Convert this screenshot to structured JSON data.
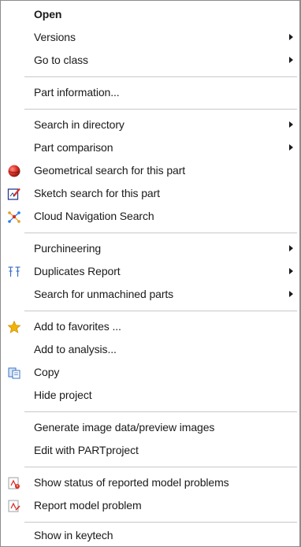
{
  "menu": {
    "items": [
      {
        "label": "Open",
        "icon": null,
        "submenu": false,
        "bold": true
      },
      {
        "label": "Versions",
        "icon": null,
        "submenu": true
      },
      {
        "label": "Go to class",
        "icon": null,
        "submenu": true
      },
      {
        "label": "Part information...",
        "icon": null,
        "submenu": false
      },
      {
        "label": "Search in directory",
        "icon": null,
        "submenu": true
      },
      {
        "label": "Part comparison",
        "icon": null,
        "submenu": true
      },
      {
        "label": "Geometrical search for this part",
        "icon": "red-sphere-icon",
        "submenu": false
      },
      {
        "label": "Sketch search for this part",
        "icon": "sketch-pencil-icon",
        "submenu": false
      },
      {
        "label": "Cloud Navigation Search",
        "icon": "cloud-network-icon",
        "submenu": false
      },
      {
        "label": "Purchineering",
        "icon": null,
        "submenu": true
      },
      {
        "label": "Duplicates Report",
        "icon": "duplicates-icon",
        "submenu": true
      },
      {
        "label": "Search for unmachined parts",
        "icon": null,
        "submenu": true
      },
      {
        "label": "Add to favorites ...",
        "icon": "star-icon",
        "submenu": false
      },
      {
        "label": "Add to analysis...",
        "icon": null,
        "submenu": false
      },
      {
        "label": "Copy",
        "icon": "copy-icon",
        "submenu": false
      },
      {
        "label": "Hide project",
        "icon": null,
        "submenu": false
      },
      {
        "label": "Generate image data/preview images",
        "icon": null,
        "submenu": false
      },
      {
        "label": "Edit with PARTproject",
        "icon": null,
        "submenu": false
      },
      {
        "label": "Show status of reported model problems",
        "icon": "model-problem-status-icon",
        "submenu": false
      },
      {
        "label": "Report model problem",
        "icon": "report-problem-icon",
        "submenu": false
      },
      {
        "label": "Show in keytech",
        "icon": null,
        "submenu": false
      }
    ]
  },
  "colors": {
    "text": "#1a1a1a",
    "separator": "#c8c8c8",
    "border": "#8c8c8c",
    "accent_red": "#d93025",
    "star_yellow": "#f2b200"
  }
}
